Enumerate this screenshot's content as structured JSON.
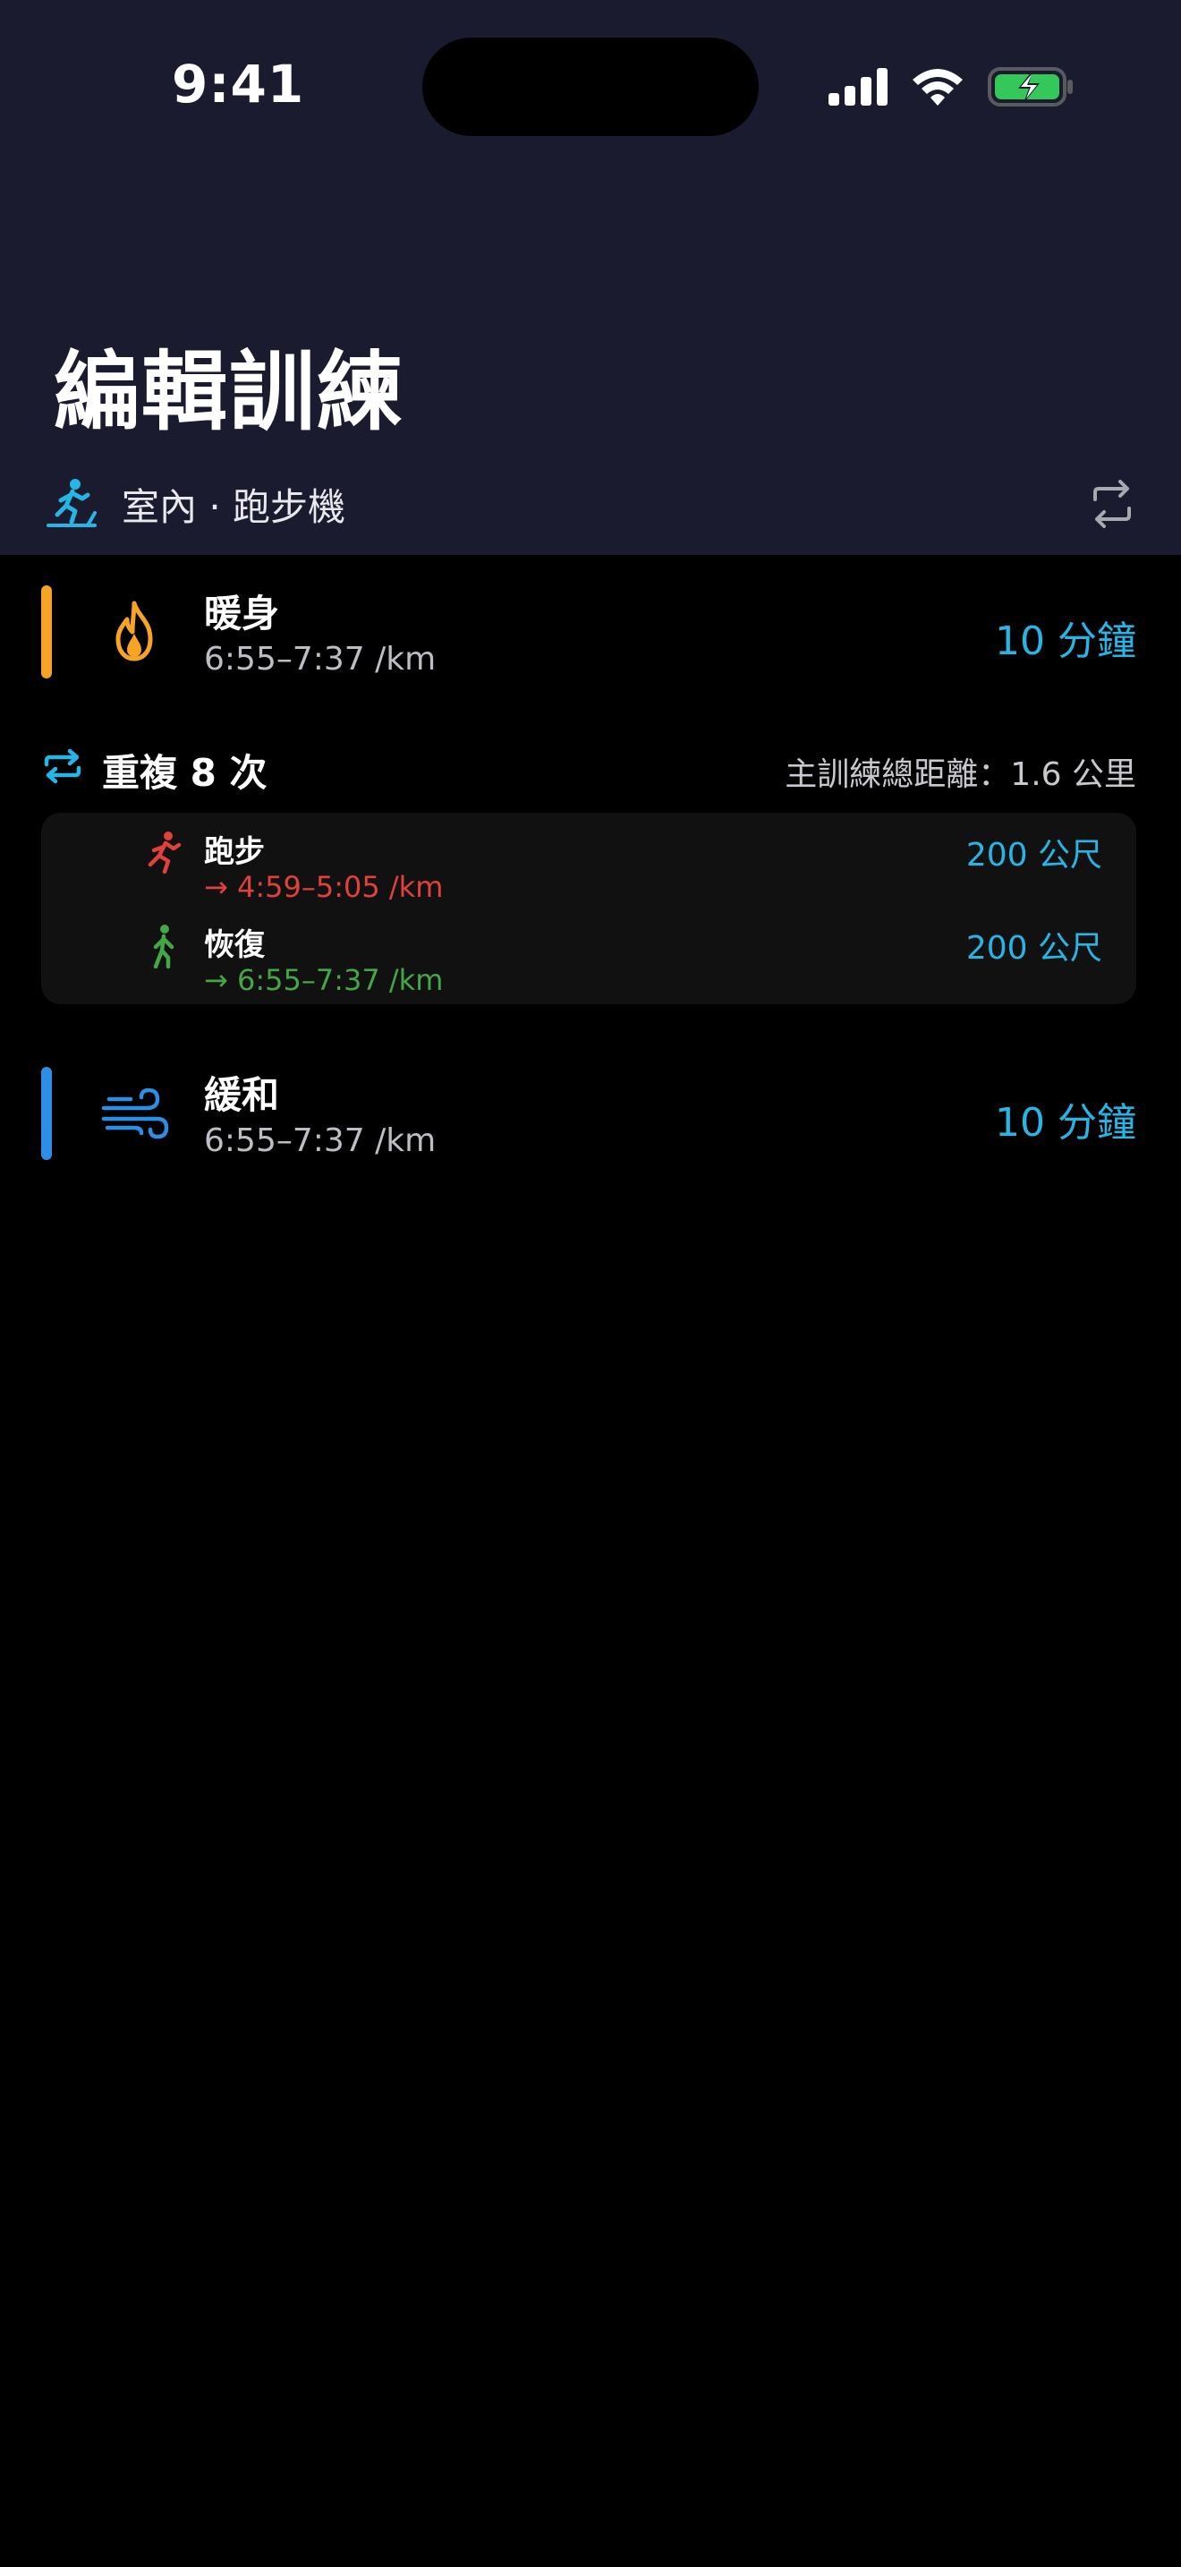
{
  "status_bar": {
    "time": "9:41",
    "icons": [
      "cellular-signal-icon",
      "wifi-icon",
      "battery-charging-icon"
    ],
    "battery_color": "#34c759"
  },
  "header": {
    "title": "編輯訓練",
    "environment": "室內 · 跑步機",
    "environment_icon": "treadmill-icon",
    "swap_icon": "swap-arrows-icon",
    "accent": "#27b5e6",
    "background": "#1a1b2e"
  },
  "warmup": {
    "name": "暖身",
    "pace": "6:55–7:37 /km",
    "duration": "10 分鐘",
    "icon": "flame-icon",
    "color": "#f7a325"
  },
  "repeat": {
    "label": "重複 8 次",
    "total_distance": "主訓練總距離：1.6 公里",
    "icon": "repeat-icon",
    "intervals": [
      {
        "name": "跑步",
        "pace": "→ 4:59–5:05 /km",
        "distance": "200 公尺",
        "icon": "running-figure-icon",
        "color": "#e0413a"
      },
      {
        "name": "恢復",
        "pace": "→ 6:55–7:37 /km",
        "distance": "200 公尺",
        "icon": "walking-figure-icon",
        "color": "#45a646"
      }
    ]
  },
  "cooldown": {
    "name": "緩和",
    "pace": "6:55–7:37 /km",
    "duration": "10 分鐘",
    "icon": "wind-icon",
    "color": "#2d8ee6"
  }
}
